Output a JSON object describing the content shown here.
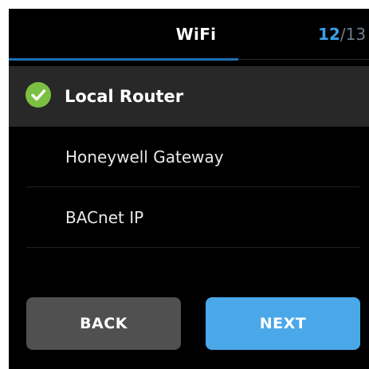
{
  "header": {
    "title": "WiFi",
    "page_current": "12",
    "page_separator": "/",
    "page_total": "13"
  },
  "options": [
    {
      "label": "Local Router",
      "selected": true
    },
    {
      "label": "Honeywell Gateway",
      "selected": false
    },
    {
      "label": "BACnet IP",
      "selected": false
    }
  ],
  "buttons": {
    "back_label": "BACK",
    "next_label": "NEXT"
  },
  "colors": {
    "accent": "#4aa7e8",
    "selected_check": "#7cc043",
    "background": "#000000",
    "selected_row": "#282828",
    "back_button": "#505050"
  },
  "icons": {
    "selected_marker": "check-circle-icon"
  }
}
